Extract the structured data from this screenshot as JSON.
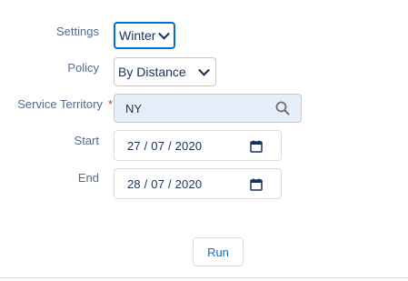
{
  "form": {
    "settings": {
      "label": "Settings",
      "value": "Winter"
    },
    "policy": {
      "label": "Policy",
      "value": "By Distance"
    },
    "service_territory": {
      "label": "Service Territory",
      "required_mark": "*",
      "value": "NY",
      "icon": "search-icon"
    },
    "start": {
      "label": "Start",
      "value": "27 / 07 / 2020",
      "icon": "calendar-icon"
    },
    "end": {
      "label": "End",
      "value": "28 / 07 / 2020",
      "icon": "calendar-icon"
    }
  },
  "actions": {
    "run_label": "Run"
  },
  "colors": {
    "accent": "#0070d2",
    "required": "#c23934",
    "lookup_background": "#e6eef9",
    "label": "#54698d"
  }
}
